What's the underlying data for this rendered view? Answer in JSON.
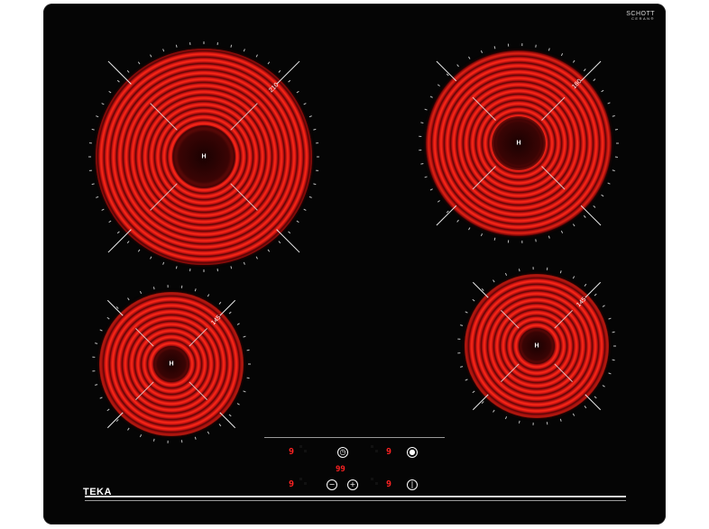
{
  "brand": {
    "name": "TEKA",
    "glass_brand_line1": "SCHOTT",
    "glass_brand_line2": "CERAN®"
  },
  "zones": [
    {
      "id": "front-left-large",
      "center_label": "H",
      "degree_label": "210"
    },
    {
      "id": "rear-right",
      "center_label": "H",
      "degree_label": "180"
    },
    {
      "id": "front-left-small",
      "center_label": "H",
      "degree_label": "145"
    },
    {
      "id": "rear-right-small",
      "center_label": "H",
      "degree_label": "145"
    }
  ],
  "controls": {
    "top_left_level": "9",
    "top_right_level": "9",
    "timer_display": "99",
    "bottom_left_level": "9",
    "bottom_right_level": "9",
    "minus_glyph": "−",
    "plus_glyph": "+",
    "power_glyph": "⏻",
    "timer_glyph": "◷",
    "lock_glyph": "🔒"
  },
  "colors": {
    "glass": "#050505",
    "zone_glow": "#e81a10",
    "display": "#ff2222"
  }
}
